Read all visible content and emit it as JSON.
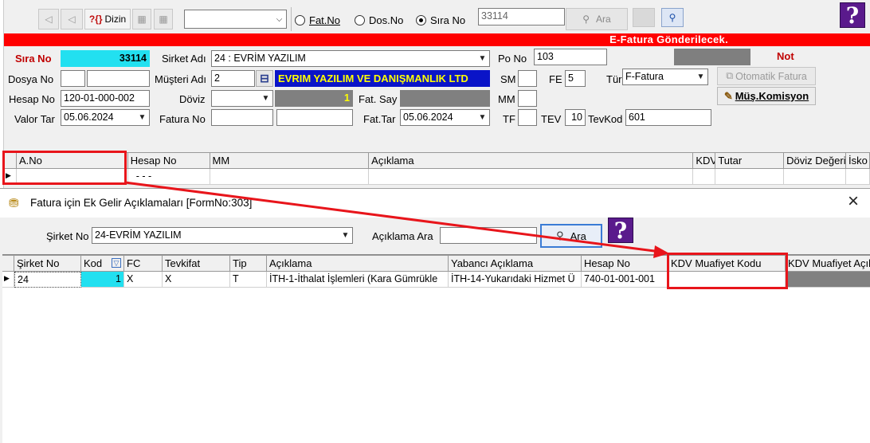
{
  "toolbar": {
    "dizin_label": "Dizin",
    "radio_fatno": "Fat.No",
    "radio_dosno": "Dos.No",
    "radio_sirano": "Sıra No",
    "search_value": "33114",
    "ara_label": "Ara",
    "help_glyph": "?"
  },
  "banner": {
    "text": "E-Fatura Gönderilecek."
  },
  "form": {
    "sira_no_label": "Sıra No",
    "sira_no_value": "33114",
    "sirket_adi_label": "Sirket Adı",
    "sirket_adi_value": "24 : EVRİM YAZILIM",
    "po_no_label": "Po No",
    "po_no_value": "103",
    "not_label": "Not",
    "dosya_no_label": "Dosya No",
    "musteri_adi_label": "Müşteri Adı",
    "musteri_code": "2",
    "musteri_name": "EVRIM YAZILIM VE DANIŞMANLIK LTD",
    "sm_label": "SM",
    "fe_label": "FE",
    "fe_value": "5",
    "tur_label": "Tür",
    "tur_value": "F-Fatura",
    "otomatik_fatura": "Otomatik Fatura",
    "hesap_no_label": "Hesap No",
    "hesap_no_value": "120-01-000-002",
    "doviz_label": "Döviz",
    "doviz_rate": "1",
    "fat_say_label": "Fat. Say",
    "mm_label": "MM",
    "mus_komisyon": "Müş.Komisyon",
    "valor_tar_label": "Valor Tar",
    "valor_tar_value": "05.06.2024",
    "fatura_no_label": "Fatura No",
    "fat_tar_label": "Fat.Tar",
    "fat_tar_value": "05.06.2024",
    "tf_label": "TF",
    "tev_label": "TEV",
    "tev_value": "10",
    "tevkod_label": "TevKod",
    "tevkod_value": "601"
  },
  "main_grid": {
    "columns": [
      "A.No",
      "Hesap No",
      "MM",
      "Açıklama",
      "KDV",
      "Tutar",
      "Döviz Değeri",
      "İsko"
    ],
    "row": {
      "hesap_no": "- - -"
    }
  },
  "dialog": {
    "title": "Fatura için Ek Gelir Açıklamaları [FormNo:303]",
    "sirket_no_label": "Şirket No",
    "sirket_no_value": "24-EVRİM YAZILIM",
    "aciklama_ara_label": "Açıklama Ara",
    "ara_label": "Ara",
    "close_glyph": "×",
    "help_glyph": "?",
    "columns": [
      "Şirket No",
      "Kod",
      "FC",
      "Tevkifat",
      "Tip",
      "Açıklama",
      "Yabancı Açıklama",
      "Hesap No",
      "KDV Muafiyet Kodu",
      "KDV Muafiyet Açıkl"
    ],
    "rows": [
      [
        "24",
        "1",
        "X",
        "X",
        "T",
        "İTH-1-İthalat İşlemleri  (Kara Gümrükle",
        "İTH-14-Yukarıdaki Hizmet Ü",
        "740-01-001-001",
        "",
        ""
      ]
    ]
  },
  "colors": {
    "banner_red": "#ff0000",
    "accent_cyan": "#22e0f0",
    "musteri_bg": "#0a14c8",
    "musteri_fg": "#ffff00",
    "annotation_red": "#e8151b",
    "help_purple": "#5a1a8c"
  }
}
